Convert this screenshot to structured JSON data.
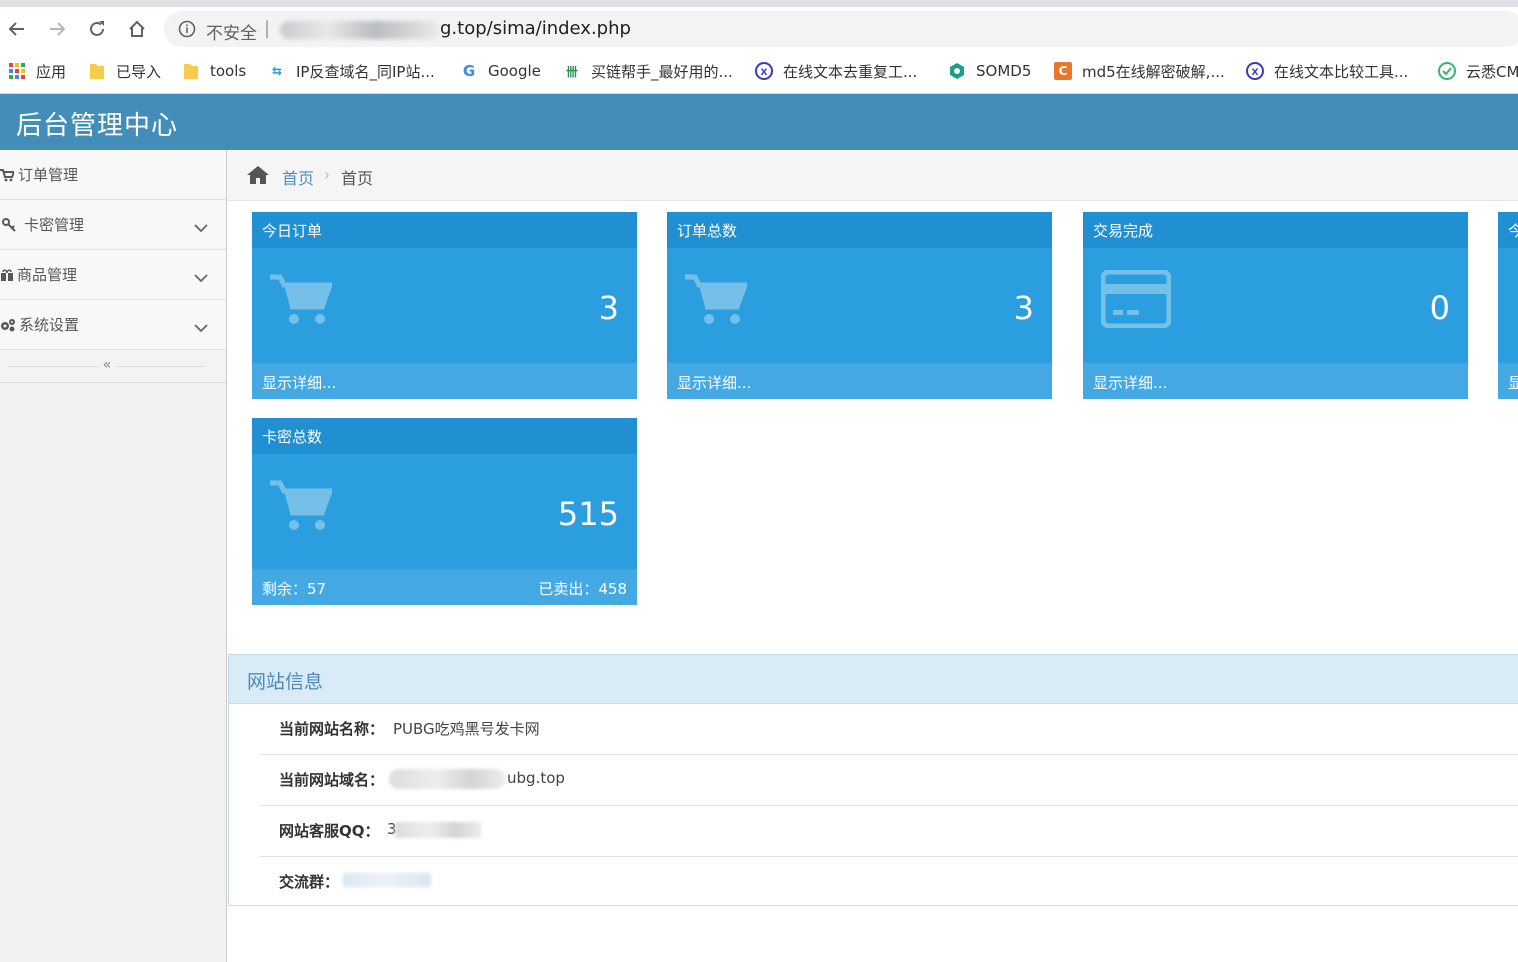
{
  "browser": {
    "insecure_label": "不安全",
    "url_visible": "g.top/sima/index.php",
    "bookmarks": [
      {
        "label": "应用",
        "icon": "apps-grid-icon"
      },
      {
        "label": "已导入",
        "icon": "folder-icon"
      },
      {
        "label": "tools",
        "icon": "folder-icon"
      },
      {
        "label": "IP反查域名_同IP站...",
        "icon": "ip-site-icon"
      },
      {
        "label": "Google",
        "icon": "google-icon"
      },
      {
        "label": "买链帮手_最好用的...",
        "icon": "link-helper-icon"
      },
      {
        "label": "在线文本去重复工...",
        "icon": "text-tool-icon"
      },
      {
        "label": "SOMD5",
        "icon": "somd5-icon"
      },
      {
        "label": "md5在线解密破解,...",
        "icon": "md5-icon"
      },
      {
        "label": "在线文本比较工具...",
        "icon": "text-tool-icon"
      },
      {
        "label": "云悉CM",
        "icon": "yunxi-icon"
      }
    ]
  },
  "header": {
    "title": "后台管理中心"
  },
  "sidebar": {
    "items": [
      {
        "label": "订单管理",
        "icon": "cart-icon",
        "expandable": false
      },
      {
        "label": "卡密管理",
        "icon": "key-icon",
        "expandable": true
      },
      {
        "label": "商品管理",
        "icon": "gift-icon",
        "expandable": true
      },
      {
        "label": "系统设置",
        "icon": "cogs-icon",
        "expandable": true
      }
    ],
    "collapse_label": "«"
  },
  "breadcrumb": {
    "home": "首页",
    "current": "首页"
  },
  "stats": [
    {
      "title": "今日订单",
      "value": "3",
      "icon": "cart-icon",
      "footer_left": "显示详细..."
    },
    {
      "title": "订单总数",
      "value": "3",
      "icon": "cart-icon",
      "footer_left": "显示详细..."
    },
    {
      "title": "交易完成",
      "value": "0",
      "icon": "credit-card-icon",
      "footer_left": "显示详细..."
    },
    {
      "title": "今",
      "value": "",
      "icon": "cart-icon",
      "footer_left": "显"
    },
    {
      "title": "卡密总数",
      "value": "515",
      "icon": "cart-icon",
      "footer_left": "剩余：57",
      "footer_right": "已卖出：458"
    }
  ],
  "site_info": {
    "heading": "网站信息",
    "rows": [
      {
        "label": "当前网站名称：",
        "value": "PUBG吃鸡黑号发卡网"
      },
      {
        "label": "当前网站域名：",
        "value": "ubg.top"
      },
      {
        "label": "网站客服QQ：",
        "value": "3"
      },
      {
        "label": "交流群：",
        "value": ""
      }
    ]
  },
  "colors": {
    "header_bg": "#438eb9",
    "panel_bg": "#2a9ede",
    "panel_head": "#2090d3",
    "panel_foot": "#44a9e3",
    "info_head_bg": "#d9ebf7"
  }
}
